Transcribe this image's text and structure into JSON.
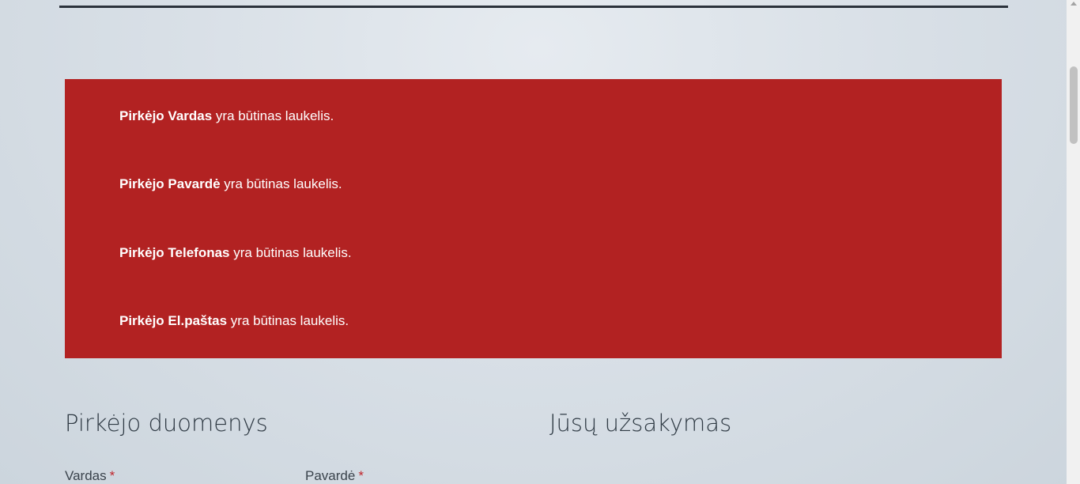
{
  "errors": [
    {
      "field": "Pirkėjo Vardas",
      "message": " yra būtinas laukelis."
    },
    {
      "field": "Pirkėjo Pavardė",
      "message": " yra būtinas laukelis."
    },
    {
      "field": "Pirkėjo Telefonas",
      "message": " yra būtinas laukelis."
    },
    {
      "field": "Pirkėjo El.paštas",
      "message": " yra būtinas laukelis."
    }
  ],
  "billing": {
    "title": "Pirkėjo duomenys",
    "first_name_label": "Vardas",
    "last_name_label": "Pavardė",
    "required_mark": "*"
  },
  "order": {
    "title": "Jūsų užsakymas"
  },
  "colors": {
    "error_background": "#b22222",
    "required_mark": "#c0272d"
  }
}
